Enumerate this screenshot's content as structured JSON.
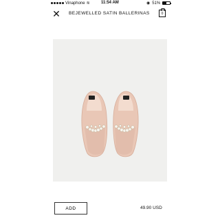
{
  "status_bar": {
    "carrier": "Vinaphone",
    "time": "11:54 AM",
    "battery_percent": "51%",
    "battery_level": 0.51,
    "icons": [
      "signal-dots",
      "wifi-icon",
      "location-icon",
      "battery-icon"
    ]
  },
  "header": {
    "title": "BEJEWELLED SATIN BALLERINAS",
    "close_icon": "✕",
    "bag_count": "0"
  },
  "product": {
    "image_description_icon": "shoe-image",
    "colors": {
      "satin": "#e9c7b6",
      "satin_shadow": "#d7ad9a",
      "insole": "#f3dccf",
      "background": "#f0f0ee"
    }
  },
  "footer": {
    "add_label": "ADD",
    "price": "49.90 USD"
  }
}
